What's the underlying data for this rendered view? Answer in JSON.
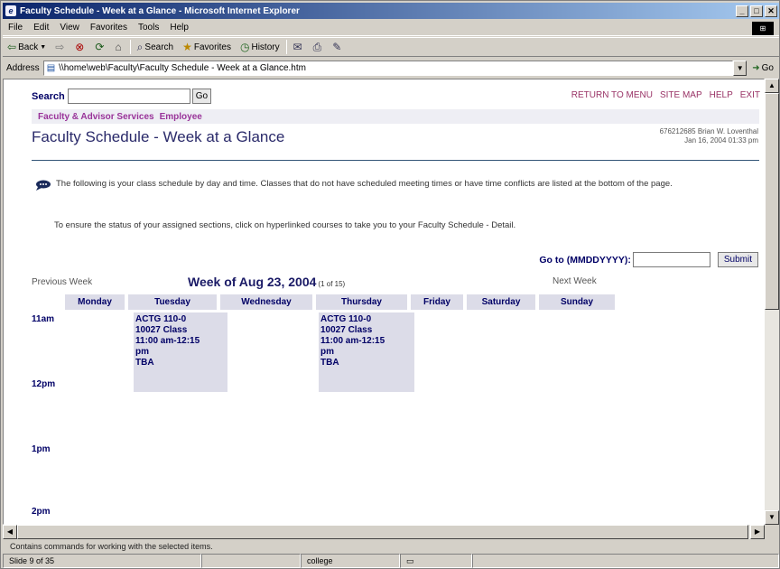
{
  "window": {
    "title": "Faculty Schedule - Week at a Glance - Microsoft Internet Explorer",
    "menu": [
      "File",
      "Edit",
      "View",
      "Favorites",
      "Tools",
      "Help"
    ],
    "toolbar": {
      "back": "Back",
      "search": "Search",
      "favorites": "Favorites",
      "history": "History"
    },
    "address_label": "Address",
    "address": "\\\\home\\web\\Faculty\\Faculty Schedule - Week at a Glance.htm",
    "go_label": "Go",
    "status_text": "Contains commands for working with the selected items.",
    "status_panels": [
      "Slide 9 of 35",
      "",
      "college",
      ""
    ]
  },
  "page": {
    "search_label": "Search",
    "search_value": "",
    "search_go": "Go",
    "toplinks": [
      "RETURN TO MENU",
      "SITE MAP",
      "HELP",
      "EXIT"
    ],
    "tabs": [
      "Faculty & Advisor Services",
      "Employee"
    ],
    "title": "Faculty Schedule - Week at a Glance",
    "user_line1": "676212685 Brian W. Loventhal",
    "user_line2": "Jan 16, 2004 01:33 pm",
    "info1": "The following is your class schedule by day and time. Classes that do not have scheduled meeting times or have time conflicts are listed at the bottom of the page.",
    "info2": "To ensure the status of your assigned sections, click on hyperlinked courses to take you to your Faculty Schedule - Detail.",
    "goto_label": "Go to (MMDDYYYY):",
    "goto_value": "",
    "submit": "Submit",
    "prev_week": "Previous Week",
    "next_week": "Next Week",
    "week_title": "Week of Aug 23, 2004",
    "week_of": "(1 of 15)",
    "days": [
      "Monday",
      "Tuesday",
      "Wednesday",
      "Thursday",
      "Friday",
      "Saturday",
      "Sunday"
    ],
    "times": [
      "11am",
      "12pm",
      "1pm",
      "2pm"
    ],
    "classes": [
      {
        "day": "Tuesday",
        "line1": "ACTG 110-0",
        "line2": "10027 Class",
        "line3": "11:00 am-12:15",
        "line4": "pm",
        "line5": "TBA"
      },
      {
        "day": "Thursday",
        "line1": "ACTG 110-0",
        "line2": "10027 Class",
        "line3": "11:00 am-12:15",
        "line4": "pm",
        "line5": "TBA"
      }
    ]
  }
}
